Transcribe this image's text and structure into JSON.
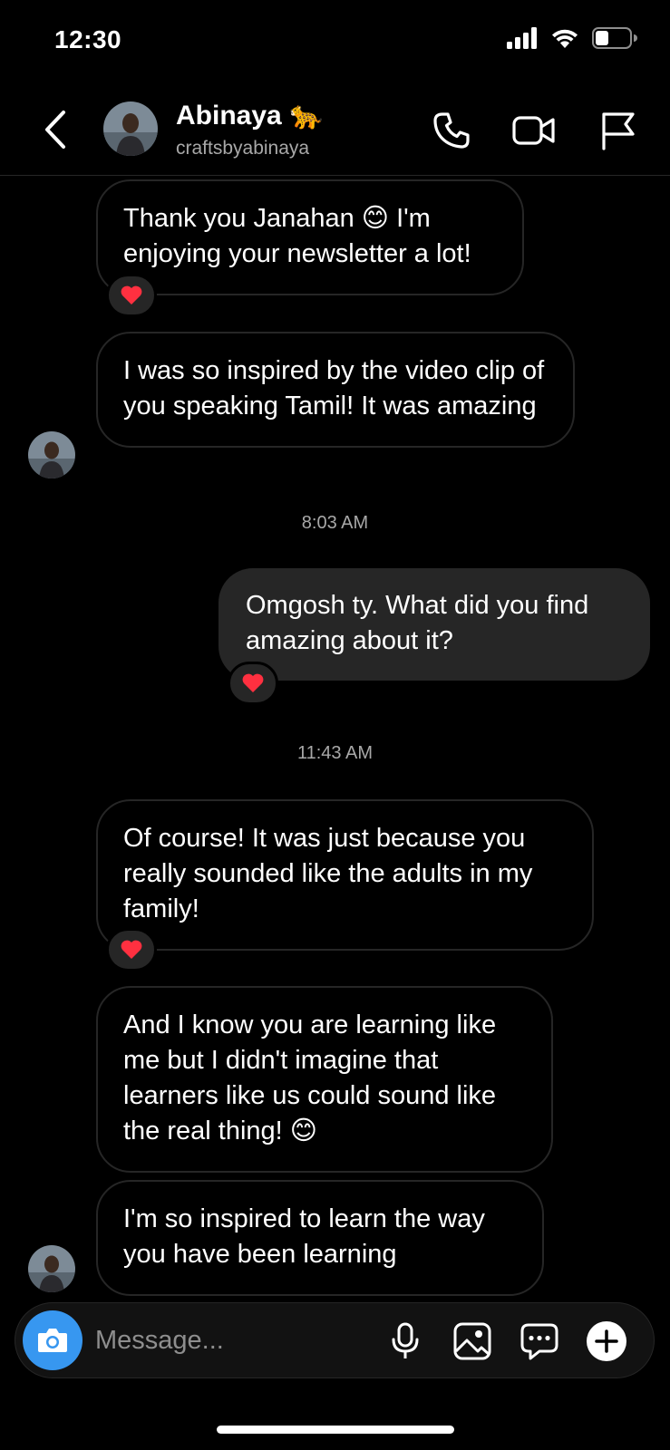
{
  "status_bar": {
    "time": "12:30"
  },
  "header": {
    "name": "Abinaya 🐆",
    "handle": "craftsbyabinaya",
    "icons": [
      "back-icon",
      "phone-icon",
      "video-icon",
      "flag-icon"
    ]
  },
  "messages": [
    {
      "direction": "incoming",
      "text": "Thank you Janahan 😊 I'm enjoying your newsletter a lot!",
      "reaction": "❤️"
    },
    {
      "direction": "incoming",
      "text": "I was so inspired by the video clip of you speaking Tamil! It was amazing"
    },
    {
      "type": "timestamp",
      "text": "8:03 AM"
    },
    {
      "direction": "outgoing",
      "text": "Omgosh ty. What did you find amazing about it?",
      "reaction": "❤️"
    },
    {
      "type": "timestamp",
      "text": "11:43 AM"
    },
    {
      "direction": "incoming",
      "text": "Of course! It was just because you really sounded like the adults in my family!",
      "reaction": "❤️"
    },
    {
      "direction": "incoming",
      "text": "And I know you are learning like me but I didn't imagine that learners like us could sound like the real thing! 😊"
    },
    {
      "direction": "incoming",
      "text": "I'm so inspired to learn the way you have been learning"
    }
  ],
  "composer": {
    "placeholder": "Message...",
    "icons": [
      "camera-icon",
      "microphone-icon",
      "gallery-icon",
      "sticker-icon",
      "plus-icon"
    ]
  },
  "colors": {
    "accent": "#3797f0",
    "bubble_out": "#262626",
    "border": "#262626",
    "muted": "#a8a8a8"
  }
}
